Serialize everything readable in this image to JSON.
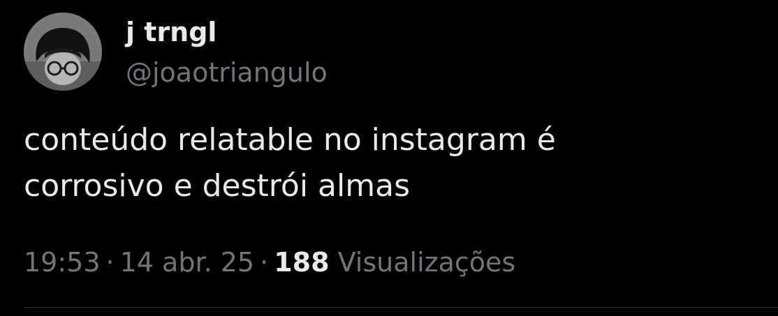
{
  "author": {
    "display_name": "j trngl",
    "handle": "@joaotriangulo",
    "avatar_icon": "profile-photo"
  },
  "tweet": {
    "text": "conteúdo relatable no instagram é\ncorrosivo e destrói almas"
  },
  "meta": {
    "time": "19:53",
    "separator": "·",
    "date": "14 abr. 25",
    "views_count": "188",
    "views_label": "Visualizações"
  },
  "colors": {
    "background": "#000000",
    "primary_text": "#e7e9ea",
    "secondary_text": "#71767b",
    "divider": "#2f3336"
  }
}
